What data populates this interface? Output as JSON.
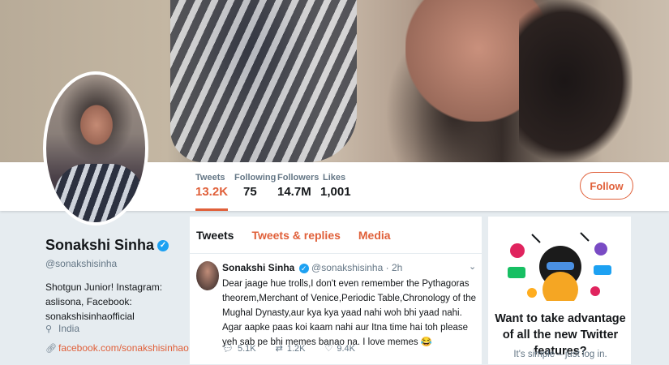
{
  "profile": {
    "name": "Sonakshi Sinha",
    "handle": "@sonakshisinha",
    "bio": "Shotgun Junior! Instagram: aslisona, Facebook: sonakshisinhaofficial",
    "location": "India",
    "link": "facebook.com/sonakshisinhao..."
  },
  "stats": [
    {
      "label": "Tweets",
      "value": "13.2K"
    },
    {
      "label": "Following",
      "value": "75"
    },
    {
      "label": "Followers",
      "value": "14.7M"
    },
    {
      "label": "Likes",
      "value": "1,001"
    }
  ],
  "follow_label": "Follow",
  "tabs": [
    "Tweets",
    "Tweets & replies",
    "Media"
  ],
  "tweet": {
    "name": "Sonakshi Sinha",
    "handle": "@sonakshisinha",
    "time": "· 2h",
    "text": "Dear jaage hue trolls,I don't even remember the Pythagoras theorem,Merchant of Venice,Periodic Table,Chronology of the Mughal Dynasty,aur kya kya yaad nahi woh bhi yaad nahi. Agar aapke paas koi kaam nahi aur Itna time hai toh please yeh sab pe bhi memes banao na. I love memes 😂",
    "replies": "5.1K",
    "retweets": "1.2K",
    "likes": "9.4K"
  },
  "promo": {
    "title": "Want to take advantage of all the new Twitter features?",
    "subtitle": "It's simple – just log in."
  },
  "colors": {
    "accent": "#e0603a",
    "verified": "#1da1f2",
    "muted": "#657786"
  },
  "icons": [
    "verified-badge-icon",
    "location-icon",
    "link-icon",
    "reply-icon",
    "retweet-icon",
    "like-icon",
    "chevron-down-icon"
  ]
}
